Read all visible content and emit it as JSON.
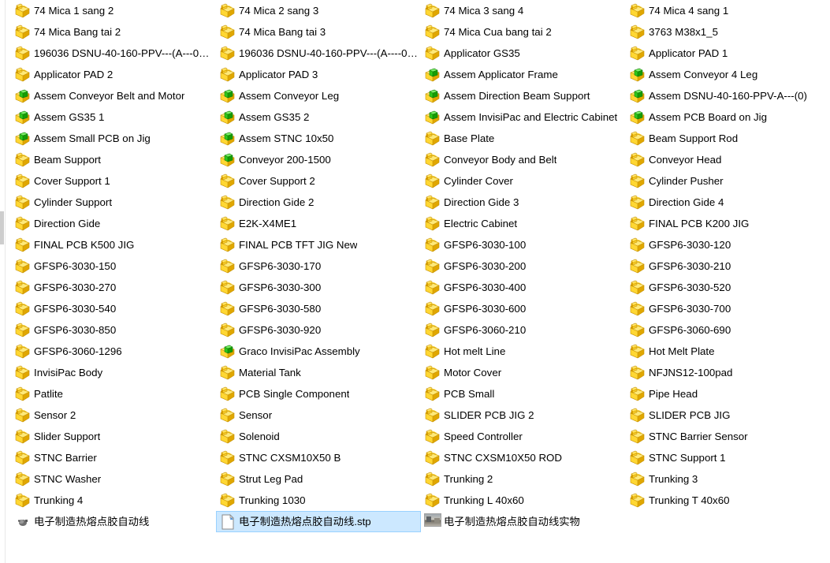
{
  "view": {
    "mode": "list",
    "columns": 4,
    "rows_per_column": 24,
    "selection_fill": "#cce8ff",
    "selection_border": "#99d1ff",
    "part_icon_color": "#f5c518",
    "assembly_icon_accent": "#22c10e",
    "text_color": "#000000",
    "background": "#ffffff"
  },
  "columns": [
    {
      "index": 0,
      "items": [
        {
          "name": "74 Mica 1 sang 2",
          "icon": "solidworks-part-icon",
          "selected": false
        },
        {
          "name": "74 Mica Bang tai 2",
          "icon": "solidworks-part-icon",
          "selected": false
        },
        {
          "name": "196036 DSNU-40-160-PPV---(A---00-...",
          "icon": "solidworks-part-icon",
          "selected": false
        },
        {
          "name": "Applicator PAD 2",
          "icon": "solidworks-part-icon",
          "selected": false
        },
        {
          "name": "Assem Conveyor Belt and Motor",
          "icon": "solidworks-assembly-icon",
          "selected": false
        },
        {
          "name": "Assem GS35 1",
          "icon": "solidworks-assembly-icon",
          "selected": false
        },
        {
          "name": "Assem Small PCB on Jig",
          "icon": "solidworks-assembly-icon",
          "selected": false
        },
        {
          "name": "Beam Support",
          "icon": "solidworks-part-icon",
          "selected": false
        },
        {
          "name": "Cover Support 1",
          "icon": "solidworks-part-icon",
          "selected": false
        },
        {
          "name": "Cylinder Support",
          "icon": "solidworks-part-icon",
          "selected": false
        },
        {
          "name": "Direction Gide",
          "icon": "solidworks-part-icon",
          "selected": false
        },
        {
          "name": "FINAL PCB K500 JIG",
          "icon": "solidworks-part-icon",
          "selected": false
        },
        {
          "name": "GFSP6-3030-150",
          "icon": "solidworks-part-icon",
          "selected": false
        },
        {
          "name": "GFSP6-3030-270",
          "icon": "solidworks-part-icon",
          "selected": false
        },
        {
          "name": "GFSP6-3030-540",
          "icon": "solidworks-part-icon",
          "selected": false
        },
        {
          "name": "GFSP6-3030-850",
          "icon": "solidworks-part-icon",
          "selected": false
        },
        {
          "name": "GFSP6-3060-1296",
          "icon": "solidworks-part-icon",
          "selected": false
        },
        {
          "name": "InvisiPac Body",
          "icon": "solidworks-part-icon",
          "selected": false
        },
        {
          "name": "Patlite",
          "icon": "solidworks-part-icon",
          "selected": false
        },
        {
          "name": "Sensor 2",
          "icon": "solidworks-part-icon",
          "selected": false
        },
        {
          "name": "Slider Support",
          "icon": "solidworks-part-icon",
          "selected": false
        },
        {
          "name": "STNC Barrier",
          "icon": "solidworks-part-icon",
          "selected": false
        },
        {
          "name": "STNC Washer",
          "icon": "solidworks-part-icon",
          "selected": false
        },
        {
          "name": "Trunking 4",
          "icon": "solidworks-part-icon",
          "selected": false
        },
        {
          "name": "电子制造热熔点胶自动线",
          "icon": "generic-app-icon",
          "selected": false
        }
      ]
    },
    {
      "index": 1,
      "items": [
        {
          "name": "74 Mica 2 sang 3",
          "icon": "solidworks-part-icon",
          "selected": false
        },
        {
          "name": "74 Mica Bang tai 3",
          "icon": "solidworks-part-icon",
          "selected": false
        },
        {
          "name": "196036 DSNU-40-160-PPV---(A----0-...",
          "icon": "solidworks-part-icon",
          "selected": false
        },
        {
          "name": "Applicator PAD 3",
          "icon": "solidworks-part-icon",
          "selected": false
        },
        {
          "name": "Assem Conveyor Leg",
          "icon": "solidworks-assembly-icon",
          "selected": false
        },
        {
          "name": "Assem GS35 2",
          "icon": "solidworks-assembly-icon",
          "selected": false
        },
        {
          "name": "Assem STNC 10x50",
          "icon": "solidworks-assembly-icon",
          "selected": false
        },
        {
          "name": "Conveyor 200-1500",
          "icon": "solidworks-assembly-icon",
          "selected": false
        },
        {
          "name": "Cover Support 2",
          "icon": "solidworks-part-icon",
          "selected": false
        },
        {
          "name": "Direction Gide 2",
          "icon": "solidworks-part-icon",
          "selected": false
        },
        {
          "name": "E2K-X4ME1",
          "icon": "solidworks-part-icon",
          "selected": false
        },
        {
          "name": "FINAL PCB TFT JIG New",
          "icon": "solidworks-part-icon",
          "selected": false
        },
        {
          "name": "GFSP6-3030-170",
          "icon": "solidworks-part-icon",
          "selected": false
        },
        {
          "name": "GFSP6-3030-300",
          "icon": "solidworks-part-icon",
          "selected": false
        },
        {
          "name": "GFSP6-3030-580",
          "icon": "solidworks-part-icon",
          "selected": false
        },
        {
          "name": "GFSP6-3030-920",
          "icon": "solidworks-part-icon",
          "selected": false
        },
        {
          "name": "Graco InvisiPac Assembly",
          "icon": "solidworks-assembly-icon",
          "selected": false
        },
        {
          "name": "Material Tank",
          "icon": "solidworks-part-icon",
          "selected": false
        },
        {
          "name": "PCB Single Component",
          "icon": "solidworks-part-icon",
          "selected": false
        },
        {
          "name": "Sensor",
          "icon": "solidworks-part-icon",
          "selected": false
        },
        {
          "name": "Solenoid",
          "icon": "solidworks-part-icon",
          "selected": false
        },
        {
          "name": "STNC CXSM10X50 B",
          "icon": "solidworks-part-icon",
          "selected": false
        },
        {
          "name": "Strut Leg Pad",
          "icon": "solidworks-part-icon",
          "selected": false
        },
        {
          "name": "Trunking 1030",
          "icon": "solidworks-part-icon",
          "selected": false
        },
        {
          "name": "电子制造热熔点胶自动线.stp",
          "icon": "stp-file-icon",
          "selected": true
        }
      ]
    },
    {
      "index": 2,
      "items": [
        {
          "name": "74 Mica 3 sang 4",
          "icon": "solidworks-part-icon",
          "selected": false
        },
        {
          "name": "74 Mica Cua bang tai 2",
          "icon": "solidworks-part-icon",
          "selected": false
        },
        {
          "name": "Applicator GS35",
          "icon": "solidworks-part-icon",
          "selected": false
        },
        {
          "name": "Assem Applicator Frame",
          "icon": "solidworks-assembly-icon",
          "selected": false
        },
        {
          "name": "Assem Direction Beam Support",
          "icon": "solidworks-assembly-icon",
          "selected": false
        },
        {
          "name": "Assem InvisiPac and Electric Cabinet",
          "icon": "solidworks-assembly-icon",
          "selected": false
        },
        {
          "name": "Base Plate",
          "icon": "solidworks-part-icon",
          "selected": false
        },
        {
          "name": "Conveyor Body and Belt",
          "icon": "solidworks-part-icon",
          "selected": false
        },
        {
          "name": "Cylinder Cover",
          "icon": "solidworks-part-icon",
          "selected": false
        },
        {
          "name": "Direction Gide 3",
          "icon": "solidworks-part-icon",
          "selected": false
        },
        {
          "name": "Electric Cabinet",
          "icon": "solidworks-part-icon",
          "selected": false
        },
        {
          "name": "GFSP6-3030-100",
          "icon": "solidworks-part-icon",
          "selected": false
        },
        {
          "name": "GFSP6-3030-200",
          "icon": "solidworks-part-icon",
          "selected": false
        },
        {
          "name": "GFSP6-3030-400",
          "icon": "solidworks-part-icon",
          "selected": false
        },
        {
          "name": "GFSP6-3030-600",
          "icon": "solidworks-part-icon",
          "selected": false
        },
        {
          "name": "GFSP6-3060-210",
          "icon": "solidworks-part-icon",
          "selected": false
        },
        {
          "name": "Hot melt Line",
          "icon": "solidworks-part-icon",
          "selected": false
        },
        {
          "name": "Motor Cover",
          "icon": "solidworks-part-icon",
          "selected": false
        },
        {
          "name": "PCB Small",
          "icon": "solidworks-part-icon",
          "selected": false
        },
        {
          "name": "SLIDER PCB JIG 2",
          "icon": "solidworks-part-icon",
          "selected": false
        },
        {
          "name": "Speed Controller",
          "icon": "solidworks-part-icon",
          "selected": false
        },
        {
          "name": "STNC CXSM10X50 ROD",
          "icon": "solidworks-part-icon",
          "selected": false
        },
        {
          "name": "Trunking 2",
          "icon": "solidworks-part-icon",
          "selected": false
        },
        {
          "name": "Trunking L 40x60",
          "icon": "solidworks-part-icon",
          "selected": false
        },
        {
          "name": "电子制造热熔点胶自动线实物",
          "icon": "photo-thumbnail-icon",
          "selected": false
        }
      ]
    },
    {
      "index": 3,
      "items": [
        {
          "name": "74 Mica 4 sang 1",
          "icon": "solidworks-part-icon",
          "selected": false
        },
        {
          "name": "3763 M38x1_5",
          "icon": "solidworks-part-icon",
          "selected": false
        },
        {
          "name": "Applicator PAD 1",
          "icon": "solidworks-part-icon",
          "selected": false
        },
        {
          "name": "Assem Conveyor 4 Leg",
          "icon": "solidworks-assembly-icon",
          "selected": false
        },
        {
          "name": "Assem DSNU-40-160-PPV-A---(0)",
          "icon": "solidworks-assembly-icon",
          "selected": false
        },
        {
          "name": "Assem PCB Board on Jig",
          "icon": "solidworks-assembly-icon",
          "selected": false
        },
        {
          "name": "Beam Support Rod",
          "icon": "solidworks-part-icon",
          "selected": false
        },
        {
          "name": "Conveyor Head",
          "icon": "solidworks-part-icon",
          "selected": false
        },
        {
          "name": "Cylinder Pusher",
          "icon": "solidworks-part-icon",
          "selected": false
        },
        {
          "name": "Direction Gide 4",
          "icon": "solidworks-part-icon",
          "selected": false
        },
        {
          "name": "FINAL PCB K200 JIG",
          "icon": "solidworks-part-icon",
          "selected": false
        },
        {
          "name": "GFSP6-3030-120",
          "icon": "solidworks-part-icon",
          "selected": false
        },
        {
          "name": "GFSP6-3030-210",
          "icon": "solidworks-part-icon",
          "selected": false
        },
        {
          "name": "GFSP6-3030-520",
          "icon": "solidworks-part-icon",
          "selected": false
        },
        {
          "name": "GFSP6-3030-700",
          "icon": "solidworks-part-icon",
          "selected": false
        },
        {
          "name": "GFSP6-3060-690",
          "icon": "solidworks-part-icon",
          "selected": false
        },
        {
          "name": "Hot Melt Plate",
          "icon": "solidworks-part-icon",
          "selected": false
        },
        {
          "name": "NFJNS12-100pad",
          "icon": "solidworks-part-icon",
          "selected": false
        },
        {
          "name": "Pipe Head",
          "icon": "solidworks-part-icon",
          "selected": false
        },
        {
          "name": "SLIDER PCB JIG",
          "icon": "solidworks-part-icon",
          "selected": false
        },
        {
          "name": "STNC Barrier Sensor",
          "icon": "solidworks-part-icon",
          "selected": false
        },
        {
          "name": "STNC Support 1",
          "icon": "solidworks-part-icon",
          "selected": false
        },
        {
          "name": "Trunking 3",
          "icon": "solidworks-part-icon",
          "selected": false
        },
        {
          "name": "Trunking T 40x60",
          "icon": "solidworks-part-icon",
          "selected": false
        }
      ]
    }
  ]
}
